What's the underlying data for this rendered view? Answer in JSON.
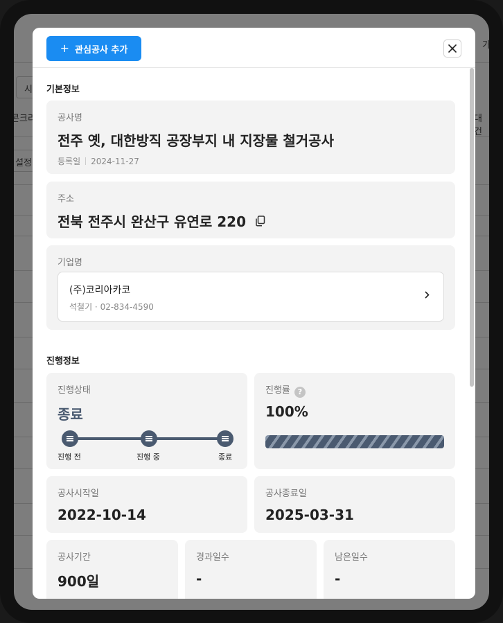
{
  "background": {
    "fragments": [
      "시",
      "콘크리",
      "설정",
      "대건",
      "가"
    ]
  },
  "header": {
    "add_button_label": "관심공사 추가",
    "plus_icon": "+",
    "close_icon": "close-icon"
  },
  "basic_info": {
    "section_title": "기본정보",
    "project": {
      "label": "공사명",
      "name": "전주 옛, 대한방직 공장부지 내 지장물 철거공사",
      "reg_label": "등록일",
      "reg_date": "2024-11-27"
    },
    "address": {
      "label": "주소",
      "value": "전북 전주시 완산구 유연로 220",
      "copy_icon": "copy-icon"
    },
    "company": {
      "label": "기업명",
      "name": "(주)코리아카코",
      "sub": "석철기 · 02-834-4590"
    }
  },
  "progress_info": {
    "section_title": "진행정보",
    "status": {
      "label": "진행상태",
      "value": "종료",
      "steps": [
        "진행 전",
        "진행 중",
        "종료"
      ]
    },
    "rate": {
      "label": "진행률",
      "help_icon": "?",
      "value": "100%",
      "fraction": 1.0
    },
    "start": {
      "label": "공사시작일",
      "value": "2022-10-14"
    },
    "end": {
      "label": "공사종료일",
      "value": "2025-03-31"
    },
    "duration": {
      "label": "공사기간",
      "value": "900일"
    },
    "elapsed": {
      "label": "경과일수",
      "value": "-"
    },
    "remaining": {
      "label": "남은일수",
      "value": "-"
    }
  },
  "colors": {
    "accent": "#1a8cf2",
    "status": "#4a5a70"
  }
}
